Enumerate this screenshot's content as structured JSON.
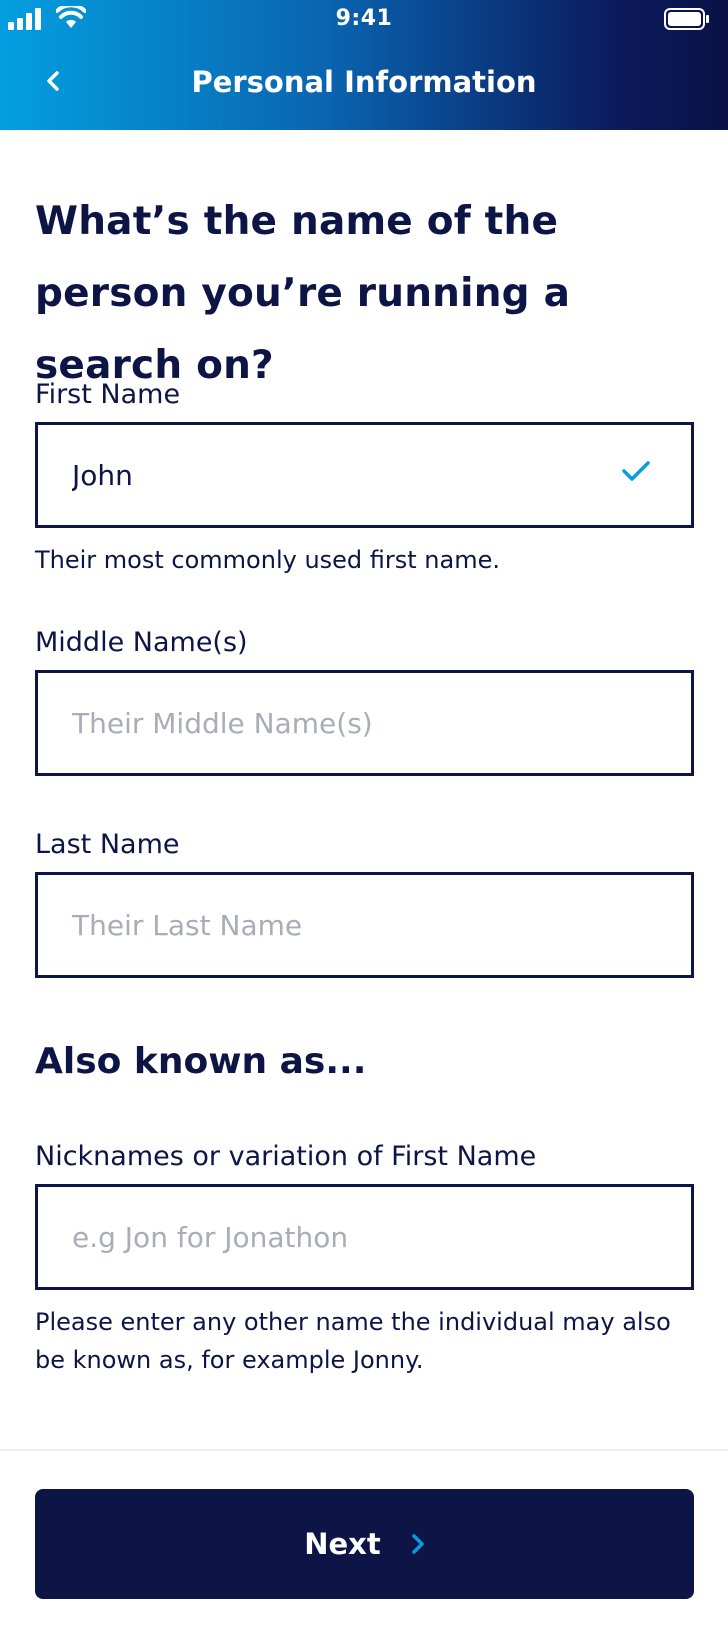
{
  "status_bar": {
    "time": "9:41"
  },
  "header": {
    "title": "Personal Information",
    "back_icon": "chevron-left-icon"
  },
  "question": "What’s the name of the person you’re running a search on?",
  "first_name": {
    "label": "First Name",
    "value": "John",
    "helper": "Their most commonly used first name.",
    "valid_icon": "check-icon"
  },
  "middle_name": {
    "label": "Middle Name(s)",
    "value": "",
    "placeholder": "Their Middle Name(s)"
  },
  "last_name": {
    "label": "Last Name",
    "value": "",
    "placeholder": "Their Last Name"
  },
  "aka": {
    "title": "Also known as...",
    "label": "Nicknames or variation of First Name",
    "value": "",
    "placeholder": "e.g Jon for Jonathon",
    "helper": "Please enter any other name the individual may also be known as, for example Jonny."
  },
  "footer": {
    "next_label": "Next",
    "next_icon": "chevron-right-icon"
  },
  "colors": {
    "navy": "#0d1547",
    "accent_blue": "#039fe0",
    "placeholder_gray": "#a9adb8",
    "header_gradient_start": "#039fe0",
    "header_gradient_end": "#0a1246"
  }
}
